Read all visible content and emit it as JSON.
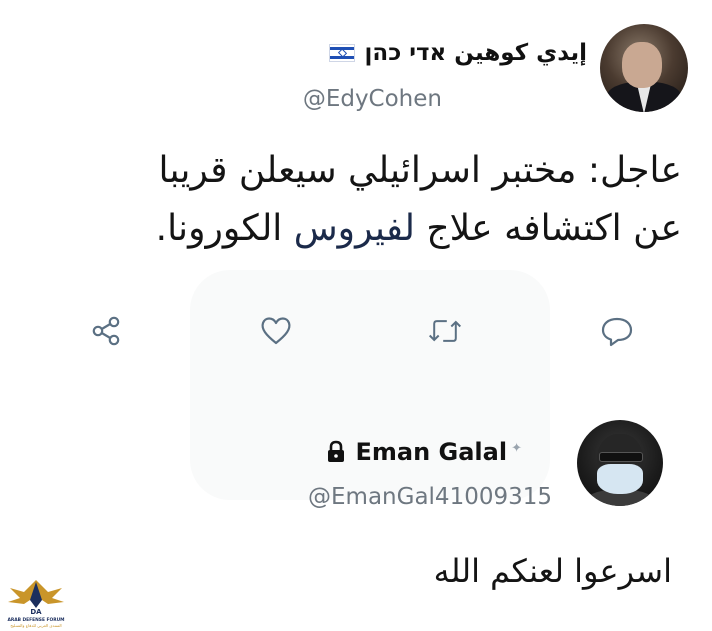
{
  "tweet1": {
    "display_name": "إيدي كوهين אדי כהן",
    "handle": "@EdyCohen",
    "flag_icon": "israel-flag-icon",
    "text_line1": "عاجل: مختبر اسرائيلي سيعلن قريبا",
    "text_line2_pre": "عن اكتشافه علاج ",
    "text_line2_link": "لفيروس",
    "text_line2_post": " الكورونا."
  },
  "actions": [
    {
      "name": "share-icon"
    },
    {
      "name": "like-icon"
    },
    {
      "name": "retweet-icon"
    },
    {
      "name": "reply-icon"
    }
  ],
  "tweet2": {
    "display_name": "Eman Galal",
    "handle": "@EmanGal41009315",
    "lock_icon": "lock-icon",
    "text": "اسرعوا لعنكم الله"
  },
  "logo": {
    "line1": "ARAB DEFENSE FORUM",
    "line2": "المنتدى العربي للدفاع والتسليح",
    "initials": "DA"
  },
  "colors": {
    "handle_gray": "#6e7780",
    "icon_blue": "#5b7083",
    "flag_blue": "#1f4fb4"
  }
}
